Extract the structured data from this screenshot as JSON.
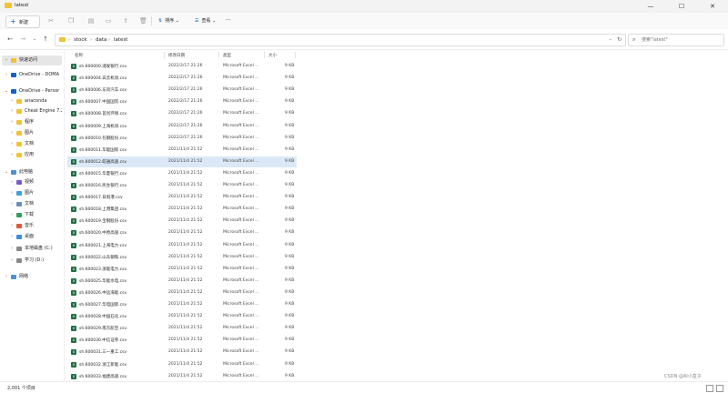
{
  "window": {
    "title": "latest",
    "min": "—",
    "max": "☐",
    "close": "✕"
  },
  "toolbar": {
    "new_label": "新建",
    "sort_label": "排序",
    "view_label": "查看",
    "more": "···"
  },
  "address": {
    "crumbs": [
      "stock",
      "data",
      "latest"
    ],
    "search_placeholder": "搜索\"latest\""
  },
  "sidebar": {
    "items": [
      {
        "label": "快速访问",
        "chev": "›",
        "icon": "star",
        "color": "#f2c232"
      },
      {
        "label": "OneDrive - DOMA",
        "chev": "›",
        "icon": "cloud",
        "color": "#0a64c8"
      },
      {
        "label": "OneDrive - Persor",
        "chev": "⌄",
        "icon": "cloud",
        "color": "#0a64c8"
      },
      {
        "label": "anaconda",
        "chev": "›",
        "icon": "folder",
        "color": "#f2c232"
      },
      {
        "label": "Cheat Engine 7.2",
        "chev": "›",
        "icon": "folder",
        "color": "#f2c232"
      },
      {
        "label": "程序",
        "chev": "›",
        "icon": "folder",
        "color": "#f2c232"
      },
      {
        "label": "图片",
        "chev": "›",
        "icon": "folder",
        "color": "#f2c232"
      },
      {
        "label": "文档",
        "chev": "›",
        "icon": "folder",
        "color": "#f2c232"
      },
      {
        "label": "应用",
        "chev": "›",
        "icon": "folder",
        "color": "#f2c232"
      },
      {
        "label": "此电脑",
        "chev": "⌄",
        "icon": "pc",
        "color": "#4a90d9"
      },
      {
        "label": "视频",
        "chev": "›",
        "icon": "video",
        "color": "#7a5bc9"
      },
      {
        "label": "图片",
        "chev": "›",
        "icon": "pictures",
        "color": "#3fa0d8"
      },
      {
        "label": "文档",
        "chev": "›",
        "icon": "docs",
        "color": "#6a8fb8"
      },
      {
        "label": "下载",
        "chev": "›",
        "icon": "download",
        "color": "#2e9e5a"
      },
      {
        "label": "音乐",
        "chev": "›",
        "icon": "music",
        "color": "#e0563b"
      },
      {
        "label": "桌面",
        "chev": "›",
        "icon": "desktop",
        "color": "#3b8ede"
      },
      {
        "label": "本地磁盘 (C:)",
        "chev": "›",
        "icon": "drive",
        "color": "#888888"
      },
      {
        "label": "学习 (D:)",
        "chev": "›",
        "icon": "drive",
        "color": "#888888"
      },
      {
        "label": "网络",
        "chev": "›",
        "icon": "network",
        "color": "#4a90d9"
      }
    ]
  },
  "columns": {
    "name": "名称",
    "date": "修改日期",
    "type": "类型",
    "size": "大小"
  },
  "files": [
    {
      "name": "sh.600000.浦发银行.csv",
      "date": "2022/2/17 21:26",
      "type": "Microsoft Excel ...",
      "size": "9 KB"
    },
    {
      "name": "sh.600004.白云机场.csv",
      "date": "2022/2/17 21:26",
      "type": "Microsoft Excel ...",
      "size": "9 KB"
    },
    {
      "name": "sh.600006.东风汽车.csv",
      "date": "2022/2/17 21:26",
      "type": "Microsoft Excel ...",
      "size": "9 KB"
    },
    {
      "name": "sh.600007.中国国贸.csv",
      "date": "2022/2/17 21:26",
      "type": "Microsoft Excel ...",
      "size": "9 KB"
    },
    {
      "name": "sh.600008.首创环保.csv",
      "date": "2022/2/17 21:26",
      "type": "Microsoft Excel ...",
      "size": "9 KB"
    },
    {
      "name": "sh.600009.上海机场.csv",
      "date": "2022/2/17 21:26",
      "type": "Microsoft Excel ...",
      "size": "9 KB"
    },
    {
      "name": "sh.600010.包钢股份.csv",
      "date": "2022/2/17 21:26",
      "type": "Microsoft Excel ...",
      "size": "9 KB"
    },
    {
      "name": "sh.600011.华能国际.csv",
      "date": "2021/11/4 21:52",
      "type": "Microsoft Excel ...",
      "size": "9 KB"
    },
    {
      "name": "sh.600012.皖通高速.csv",
      "date": "2021/11/4 21:52",
      "type": "Microsoft Excel ...",
      "size": "9 KB"
    },
    {
      "name": "sh.600015.华夏银行.csv",
      "date": "2021/11/4 21:52",
      "type": "Microsoft Excel ...",
      "size": "9 KB"
    },
    {
      "name": "sh.600016.民生银行.csv",
      "date": "2021/11/4 21:52",
      "type": "Microsoft Excel ...",
      "size": "9 KB"
    },
    {
      "name": "sh.600017.日照港.csv",
      "date": "2021/11/4 21:52",
      "type": "Microsoft Excel ...",
      "size": "9 KB"
    },
    {
      "name": "sh.600018.上港集团.csv",
      "date": "2021/11/4 21:52",
      "type": "Microsoft Excel ...",
      "size": "9 KB"
    },
    {
      "name": "sh.600019.宝钢股份.csv",
      "date": "2021/11/4 21:52",
      "type": "Microsoft Excel ...",
      "size": "9 KB"
    },
    {
      "name": "sh.600020.中原高速.csv",
      "date": "2021/11/4 21:52",
      "type": "Microsoft Excel ...",
      "size": "9 KB"
    },
    {
      "name": "sh.600021.上海电力.csv",
      "date": "2021/11/4 21:52",
      "type": "Microsoft Excel ...",
      "size": "9 KB"
    },
    {
      "name": "sh.600022.山东钢铁.csv",
      "date": "2021/11/4 21:52",
      "type": "Microsoft Excel ...",
      "size": "9 KB"
    },
    {
      "name": "sh.600023.浙能电力.csv",
      "date": "2021/11/4 21:52",
      "type": "Microsoft Excel ...",
      "size": "9 KB"
    },
    {
      "name": "sh.600025.华能水电.csv",
      "date": "2021/11/4 21:52",
      "type": "Microsoft Excel ...",
      "size": "9 KB"
    },
    {
      "name": "sh.600026.中远海能.csv",
      "date": "2021/11/4 21:52",
      "type": "Microsoft Excel ...",
      "size": "9 KB"
    },
    {
      "name": "sh.600027.华电国际.csv",
      "date": "2021/11/4 21:52",
      "type": "Microsoft Excel ...",
      "size": "9 KB"
    },
    {
      "name": "sh.600028.中国石化.csv",
      "date": "2021/11/4 21:52",
      "type": "Microsoft Excel ...",
      "size": "9 KB"
    },
    {
      "name": "sh.600029.南方航空.csv",
      "date": "2021/11/4 21:52",
      "type": "Microsoft Excel ...",
      "size": "9 KB"
    },
    {
      "name": "sh.600030.中信证券.csv",
      "date": "2021/11/4 21:52",
      "type": "Microsoft Excel ...",
      "size": "9 KB"
    },
    {
      "name": "sh.600031.三一重工.csv",
      "date": "2021/11/4 21:52",
      "type": "Microsoft Excel ...",
      "size": "9 KB"
    },
    {
      "name": "sh.600032.浙江新能.csv",
      "date": "2021/11/4 21:52",
      "type": "Microsoft Excel ...",
      "size": "9 KB"
    },
    {
      "name": "sh.600033.福建高速.csv",
      "date": "2021/11/4 21:52",
      "type": "Microsoft Excel ...",
      "size": "9 KB"
    }
  ],
  "status": {
    "count": "2,001 个项目"
  },
  "watermark": "CSDN @AI小盒子"
}
